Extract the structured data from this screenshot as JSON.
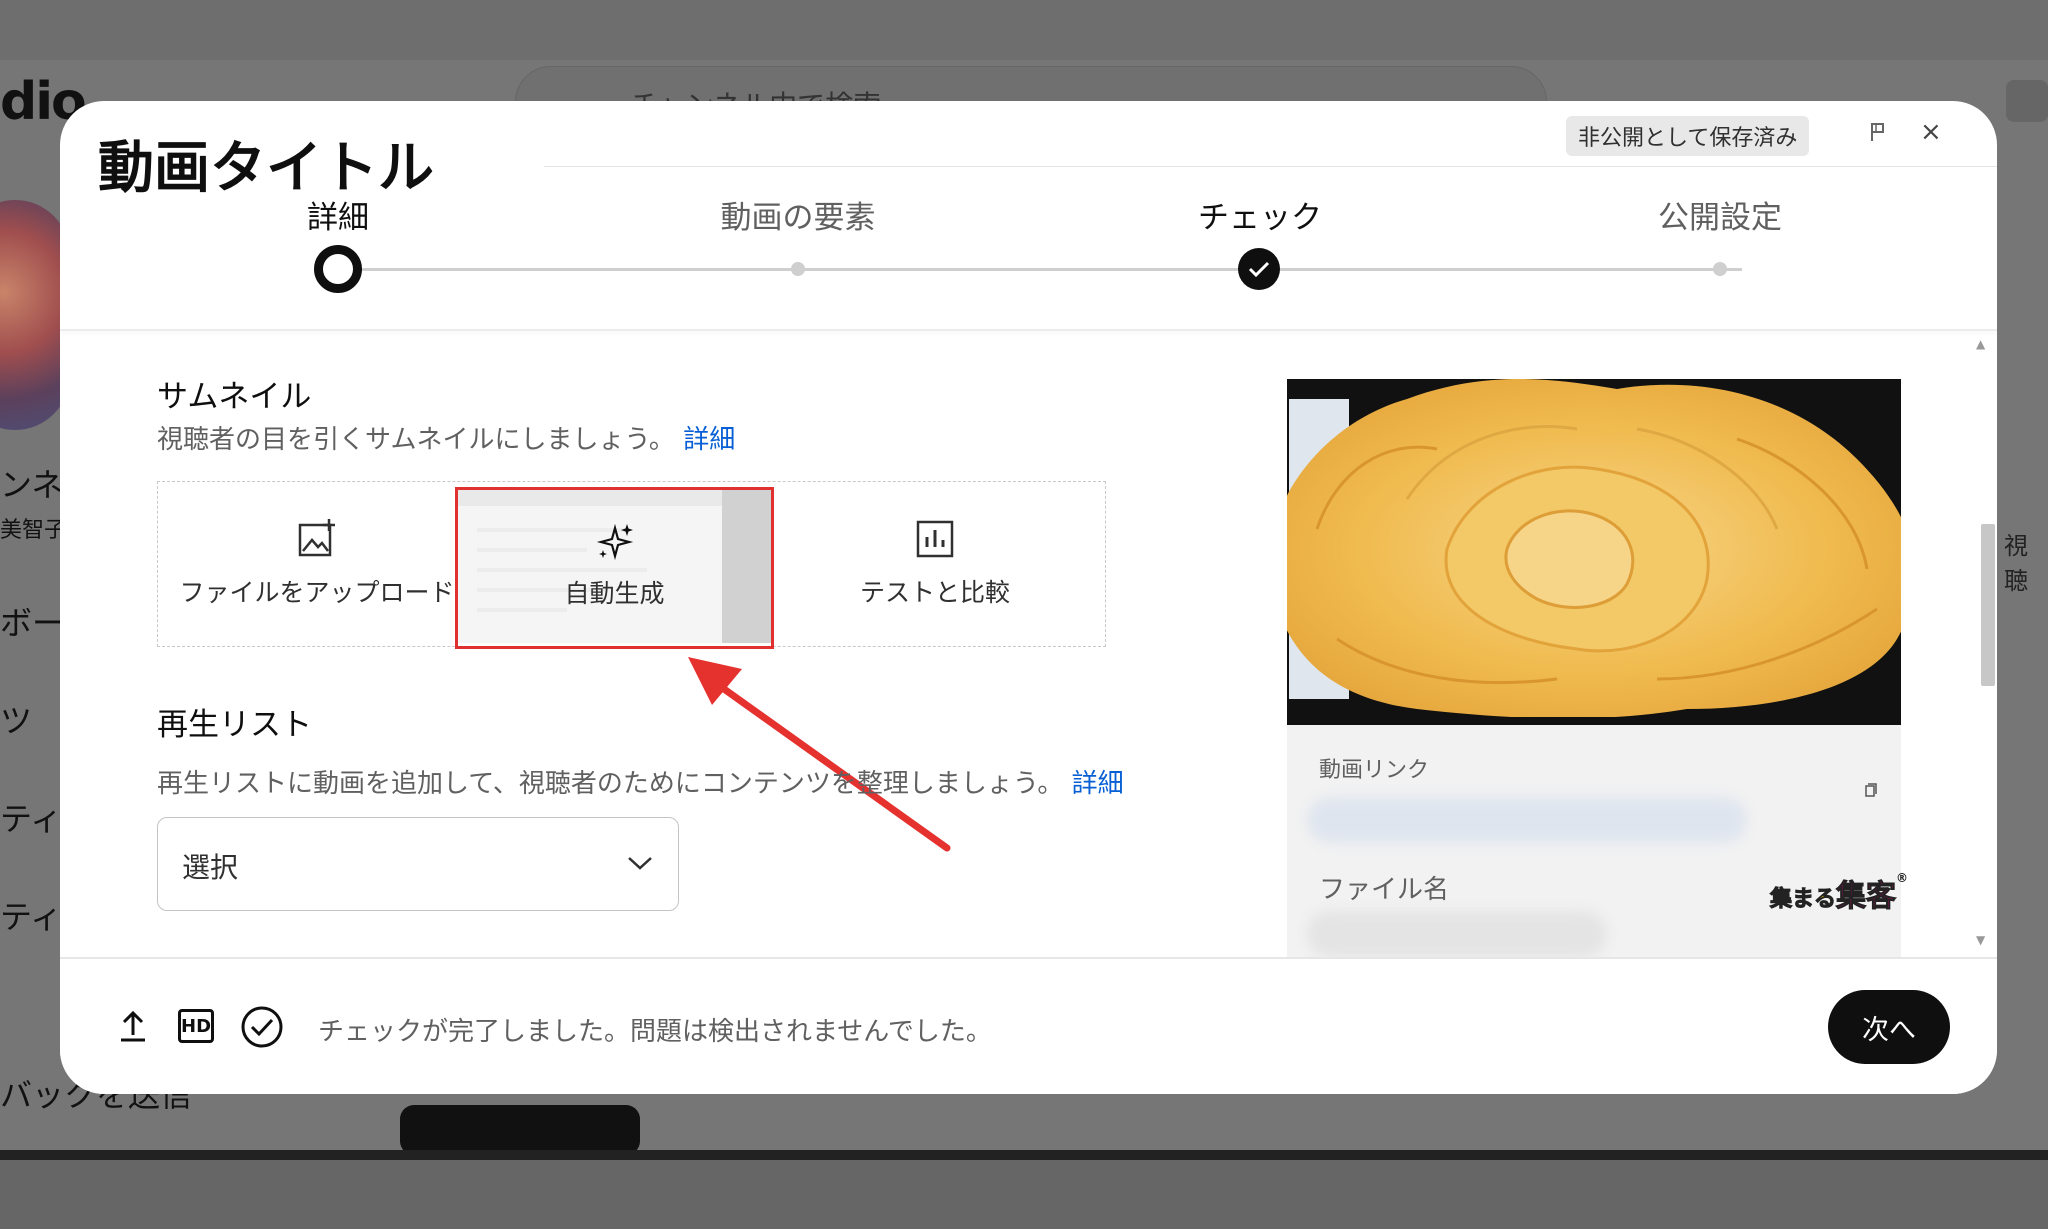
{
  "background": {
    "logo_fragment": "dio",
    "search_placeholder": "チャンネル内で検索",
    "sidebar_fragments": [
      "ンネル",
      "美智子",
      "ボー",
      "ツ",
      "ティク",
      "ティ",
      "バックを送信"
    ],
    "right_fragment": "視聴"
  },
  "dialog": {
    "title": "動画タイトル",
    "saved_status": "非公開として保存済み",
    "close_symbol": "×"
  },
  "stepper": {
    "steps": [
      {
        "label": "詳細",
        "state": "current"
      },
      {
        "label": "動画の要素",
        "state": "pending"
      },
      {
        "label": "チェック",
        "state": "done"
      },
      {
        "label": "公開設定",
        "state": "pending"
      }
    ]
  },
  "thumbnail": {
    "heading": "サムネイル",
    "description": "視聴者の目を引くサムネイルにしましょう。",
    "learn_more": "詳細",
    "options": [
      {
        "label": "ファイルをアップロード",
        "icon": "add-photo-icon"
      },
      {
        "label": "自動生成",
        "icon": "sparkle-icon"
      },
      {
        "label": "テストと比較",
        "icon": "bar-chart-icon"
      }
    ]
  },
  "playlist": {
    "heading": "再生リスト",
    "description": "再生リストに動画を追加して、視聴者のためにコンテンツを整理しましょう。",
    "learn_more": "詳細",
    "select_value": "選択"
  },
  "preview": {
    "video_link_label": "動画リンク",
    "file_name_label": "ファイル名"
  },
  "brand": {
    "text_small": "集まる",
    "text_big": "集客",
    "mark": "®"
  },
  "footer": {
    "status": "チェックが完了しました。問題は検出されませんでした。",
    "hd_label": "HD",
    "next_button": "次へ"
  },
  "colors": {
    "accent_link": "#065fd4",
    "highlight": "#e0302f",
    "primary": "#0f0f0f"
  }
}
